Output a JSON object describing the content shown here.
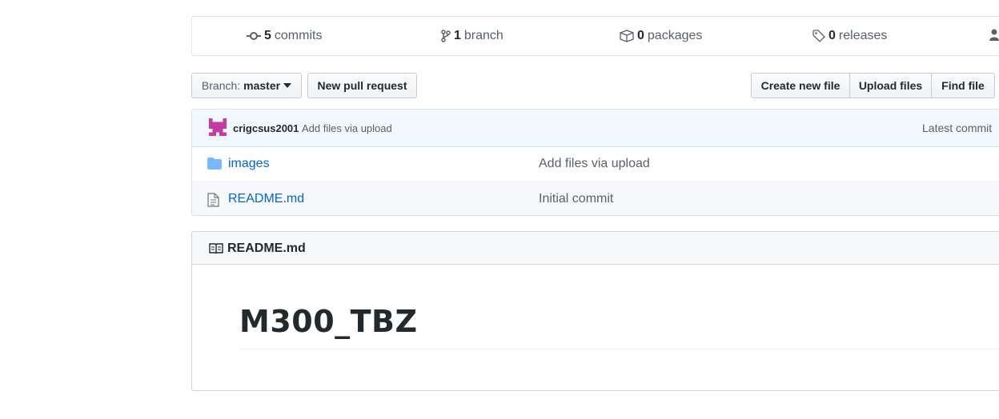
{
  "numbers_summary": {
    "commits": {
      "count": "5",
      "label": "commits",
      "icon": "commit-icon"
    },
    "branches": {
      "count": "1",
      "label": "branch",
      "icon": "branch-icon"
    },
    "packages": {
      "count": "0",
      "label": "packages",
      "icon": "package-icon"
    },
    "releases": {
      "count": "0",
      "label": "releases",
      "icon": "tag-icon"
    }
  },
  "toolbar": {
    "branch_prefix": "Branch:",
    "branch_name": "master",
    "new_pull_request": "New pull request",
    "create_new_file": "Create new file",
    "upload_files": "Upload files",
    "find_file": "Find file"
  },
  "latest_commit": {
    "author": "crigcsus2001",
    "message": "Add files via upload",
    "latest_label": "Latest commit"
  },
  "files": [
    {
      "name": "images",
      "type": "directory",
      "message": "Add files via upload"
    },
    {
      "name": "README.md",
      "type": "file",
      "message": "Initial commit"
    }
  ],
  "readme": {
    "filename": "README.md",
    "heading": "M300_TBZ"
  },
  "colors": {
    "link": "#0366d6",
    "avatar": "#c33d9e",
    "folder": "#79b8ff"
  }
}
